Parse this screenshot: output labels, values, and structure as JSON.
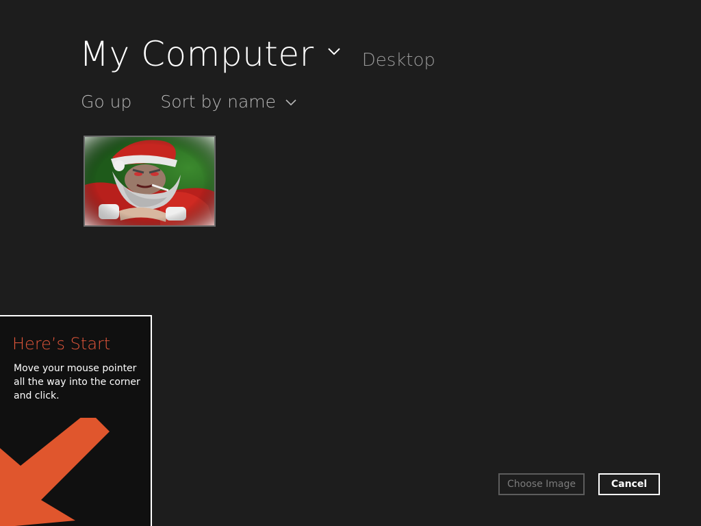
{
  "header": {
    "title": "My Computer",
    "location_link": "Desktop"
  },
  "toolbar": {
    "go_up_label": "Go up",
    "sort_label": "Sort by name"
  },
  "files": [
    {
      "kind": "image",
      "description_icon": "santa-image-thumbnail"
    }
  ],
  "start_tip": {
    "title": "Here’s Start",
    "body": "Move your mouse pointer all the way into the corner and click."
  },
  "buttons": {
    "choose_label": "Choose Image",
    "cancel_label": "Cancel"
  },
  "colors": {
    "background": "#1d1d1d",
    "accent_orange": "#e4573b",
    "arrow_orange": "#e0562d"
  }
}
